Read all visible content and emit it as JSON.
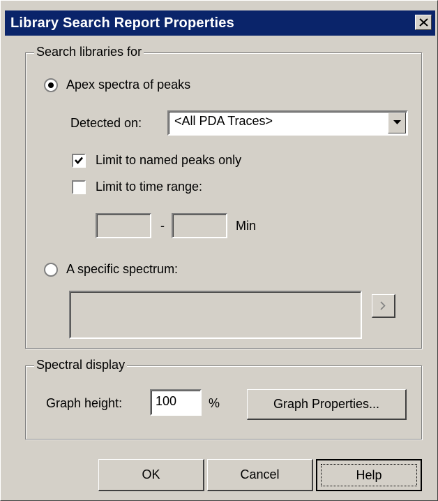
{
  "window": {
    "title": "Library Search Report Properties",
    "close_icon": "close-icon"
  },
  "search_group": {
    "legend": "Search libraries for",
    "apex_radio": {
      "label": "Apex spectra of peaks",
      "selected": true
    },
    "detected_on": {
      "label": "Detected on:",
      "value": "<All PDA Traces>"
    },
    "limit_named": {
      "label": "Limit to named peaks only",
      "checked": true
    },
    "limit_time": {
      "label": "Limit to time range:",
      "checked": false
    },
    "time_range": {
      "from_value": "",
      "separator": "-",
      "to_value": "",
      "unit": "Min"
    },
    "specific_radio": {
      "label": "A specific spectrum:",
      "selected": false
    },
    "specific_field_value": "",
    "browse_icon": "chevron-right-icon"
  },
  "display_group": {
    "legend": "Spectral display",
    "graph_height": {
      "label": "Graph height:",
      "value": "100",
      "unit": "%"
    },
    "graph_properties_label": "Graph Properties..."
  },
  "buttons": {
    "ok": "OK",
    "cancel": "Cancel",
    "help": "Help"
  },
  "colors": {
    "titlebar": "#0a246a",
    "face": "#d4d0c8"
  }
}
